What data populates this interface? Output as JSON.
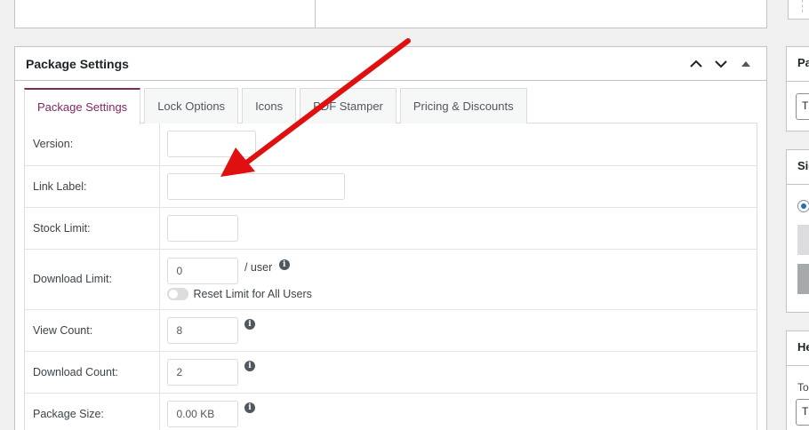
{
  "postbox": {
    "title": "Package Settings"
  },
  "tabs": [
    {
      "label": "Package Settings",
      "active": true
    },
    {
      "label": "Lock Options",
      "active": false
    },
    {
      "label": "Icons",
      "active": false
    },
    {
      "label": "PDF Stamper",
      "active": false
    },
    {
      "label": "Pricing & Discounts",
      "active": false
    }
  ],
  "fields": {
    "version": {
      "label": "Version:",
      "value": ""
    },
    "link_label": {
      "label": "Link Label:",
      "value": ""
    },
    "stock_limit": {
      "label": "Stock Limit:",
      "value": ""
    },
    "download_limit": {
      "label": "Download Limit:",
      "value": "0",
      "suffix": "/ user",
      "reset_label": "Reset Limit for All Users"
    },
    "view_count": {
      "label": "View Count:",
      "value": "8"
    },
    "download_count": {
      "label": "Download Count:",
      "value": "2"
    },
    "package_size": {
      "label": "Package Size:",
      "value": "0.00 KB"
    }
  },
  "sidebar": {
    "box1_title": "Pa",
    "box1_input": "T",
    "box2_title": "Sid",
    "box3_title": "He",
    "box3_label": "To",
    "box3_input": "T"
  },
  "colors": {
    "accent": "#7c2a5e",
    "arrow": "#e01010",
    "radio": "#2271b1"
  },
  "icons": {
    "info": "info-icon",
    "collapse_up": "chevron-up-icon",
    "collapse_down": "chevron-down-icon",
    "toggle": "triangle-up-icon"
  }
}
